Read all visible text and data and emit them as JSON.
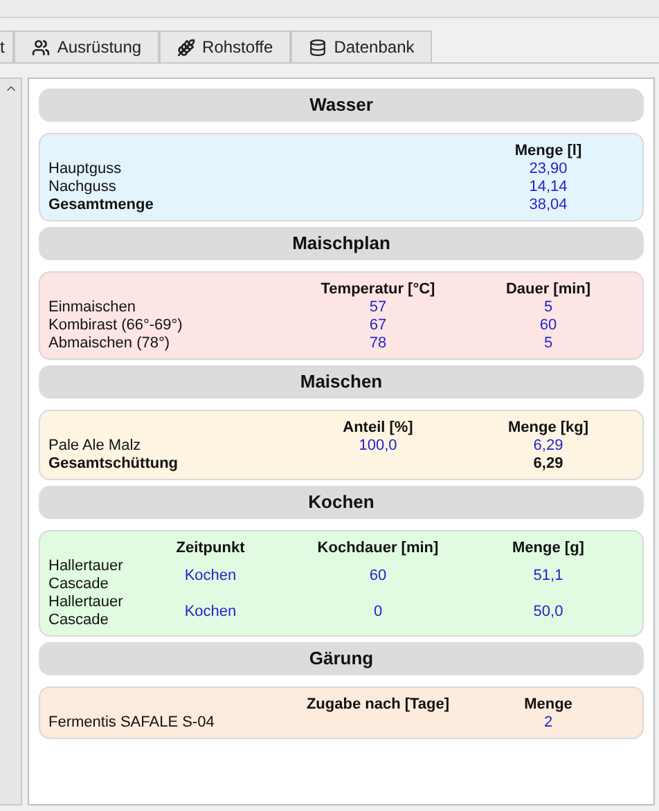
{
  "tabs": [
    {
      "label": "t",
      "kind": "plain",
      "selected": false
    },
    {
      "label": "Ausrüstung",
      "kind": "people",
      "selected": false
    },
    {
      "label": "Rohstoffe",
      "kind": "grain",
      "selected": false
    },
    {
      "label": "Datenbank",
      "kind": "database",
      "selected": false
    }
  ],
  "sections": [
    {
      "title": "Wasser",
      "color": "#e4f4fd",
      "columns": [
        "Menge [l]"
      ],
      "rows": [
        {
          "name": "Hauptguss",
          "bold": false,
          "linked": true,
          "values": {
            "col_1": "23,90"
          }
        },
        {
          "name": "Nachguss",
          "bold": false,
          "linked": true,
          "values": {
            "col_1": "14,14"
          }
        },
        {
          "name": "Gesamtmenge",
          "bold": true,
          "linked": true,
          "values": {
            "col_1": "38,04"
          }
        }
      ]
    },
    {
      "title": "Maischplan",
      "color": "#fde5e3",
      "columns": [
        "Temperatur [°C]",
        "Dauer [min]"
      ],
      "rows": [
        {
          "name": "Einmaischen",
          "bold": false,
          "linked": true,
          "values": {
            "col_1": "57",
            "col_2": "5"
          }
        },
        {
          "name": "Kombirast (66°-69°)",
          "bold": false,
          "linked": true,
          "values": {
            "col_1": "67",
            "col_2": "60"
          }
        },
        {
          "name": "Abmaischen (78°)",
          "bold": false,
          "linked": true,
          "values": {
            "col_1": "78",
            "col_2": "5"
          }
        }
      ]
    },
    {
      "title": "Maischen",
      "color": "#fdf5e2",
      "columns": [
        "Anteil [%]",
        "Menge [kg]"
      ],
      "rows": [
        {
          "name": "Pale Ale Malz",
          "bold": false,
          "linked": true,
          "values": {
            "col_1": "100,0",
            "col_2": "6,29"
          }
        },
        {
          "name": "Gesamtschüttung",
          "bold": true,
          "linked": false,
          "values": {
            "col_2": "6,29"
          }
        }
      ]
    },
    {
      "title": "Kochen",
      "color": "#e0fbe1",
      "columns": [
        "Zeitpunkt",
        "Kochdauer [min]",
        "Menge [g]"
      ],
      "rows": [
        {
          "name": "Hallertauer Cascade",
          "bold": false,
          "linked": true,
          "values": {
            "col_1": "Kochen",
            "col_2": "60",
            "col_3": "51,1"
          }
        },
        {
          "name": "Hallertauer Cascade",
          "bold": false,
          "linked": true,
          "values": {
            "col_1": "Kochen",
            "col_2": "0",
            "col_3": "50,0"
          }
        }
      ]
    },
    {
      "title": "Gärung",
      "color": "#fdebdd",
      "columns": [
        "Zugabe nach [Tage]",
        "Menge"
      ],
      "rows": [
        {
          "name": "Fermentis SAFALE S-04",
          "bold": false,
          "linked": true,
          "values": {
            "col_2": "2"
          }
        }
      ]
    }
  ]
}
